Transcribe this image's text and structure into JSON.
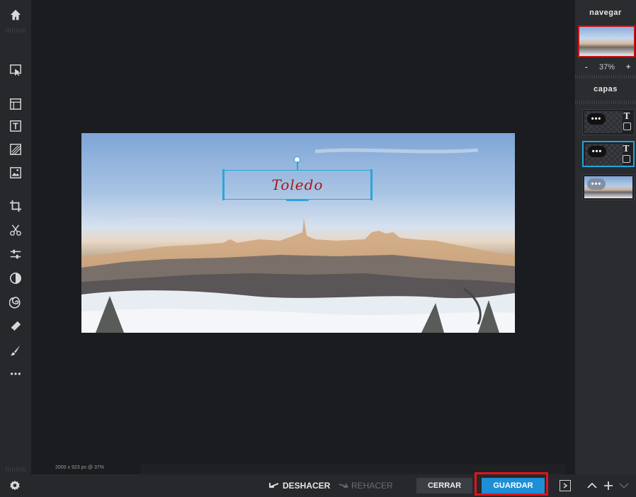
{
  "toolbar": {
    "items": [
      {
        "name": "home-icon"
      },
      {
        "name": "arrange-icon"
      },
      {
        "name": "layout-icon"
      },
      {
        "name": "text-icon"
      },
      {
        "name": "texture-icon"
      },
      {
        "name": "image-icon"
      },
      {
        "name": "crop-icon"
      },
      {
        "name": "cut-icon"
      },
      {
        "name": "adjust-icon"
      },
      {
        "name": "contrast-icon"
      },
      {
        "name": "spiral-icon"
      },
      {
        "name": "eraser-icon"
      },
      {
        "name": "brush-icon"
      },
      {
        "name": "more-icon"
      }
    ],
    "settings_icon": "gear-icon"
  },
  "canvas": {
    "text_layer": "Toledo",
    "status": "2000 x 923 px @ 37%"
  },
  "bottom_bar": {
    "undo_label": "DESHACER",
    "redo_label": "REHACER",
    "close_label": "CERRAR",
    "save_label": "GUARDAR"
  },
  "right_panel": {
    "navigate_title": "navegar",
    "zoom_minus": "-",
    "zoom_value": "37%",
    "zoom_plus": "+",
    "layers_title": "capas",
    "layers": [
      {
        "kind": "text",
        "dots": "•••",
        "type_icon": "T"
      },
      {
        "kind": "text",
        "dots": "•••",
        "type_icon": "T",
        "selected": true
      },
      {
        "kind": "image",
        "dots": "•••"
      }
    ]
  },
  "colors": {
    "accent": "#1e8fd6",
    "highlight": "#e0141a",
    "text_layer": "#a31b1b"
  }
}
